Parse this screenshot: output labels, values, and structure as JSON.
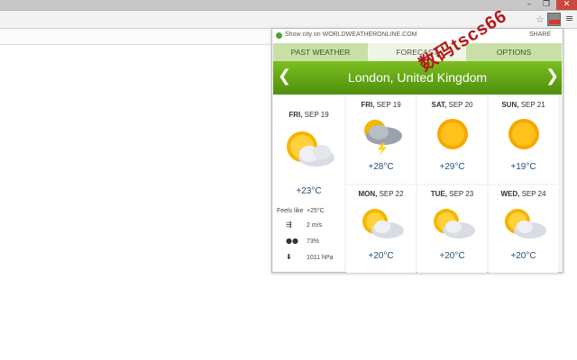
{
  "window": {
    "minimize_glyph": "–",
    "maximize_glyph": "❐",
    "close_glyph": "✕"
  },
  "toolbar": {
    "star_glyph": "☆",
    "menu_glyph": "≡"
  },
  "popup": {
    "showcity_text": "Show city on WORLDWEATHERONLINE.COM",
    "share_label": "SHARE",
    "tabs": [
      {
        "label": "PAST WEATHER"
      },
      {
        "label": "FORECAST"
      },
      {
        "label": "OPTIONS"
      }
    ],
    "location": "London, United Kingdom",
    "prev_glyph": "❮",
    "next_glyph": "❯",
    "today": {
      "dow": "FRI,",
      "date": "SEP 19",
      "temp": "+23°C",
      "icon": "partly-cloudy-icon",
      "feels_like_label": "Feels like",
      "feels_like": "+25°C",
      "wind": "2 m/s",
      "humidity": "73%",
      "pressure": "1011 hPa"
    },
    "forecast": [
      {
        "dow": "FRI,",
        "date": "SEP 19",
        "temp": "+28°C",
        "icon": "storm-icon"
      },
      {
        "dow": "SAT,",
        "date": "SEP 20",
        "temp": "+29°C",
        "icon": "sunny-icon"
      },
      {
        "dow": "SUN,",
        "date": "SEP 21",
        "temp": "+19°C",
        "icon": "sunny-icon"
      },
      {
        "dow": "MON,",
        "date": "SEP 22",
        "temp": "+20°C",
        "icon": "partly-cloudy-icon"
      },
      {
        "dow": "TUE,",
        "date": "SEP 23",
        "temp": "+20°C",
        "icon": "partly-cloudy-icon"
      },
      {
        "dow": "WED,",
        "date": "SEP 24",
        "temp": "+20°C",
        "icon": "partly-cloudy-icon"
      }
    ]
  },
  "watermark": "数码tscs66",
  "colors": {
    "accent_green": "#5ea516",
    "temp_blue": "#24507a",
    "watermark_red": "#b3191c"
  }
}
